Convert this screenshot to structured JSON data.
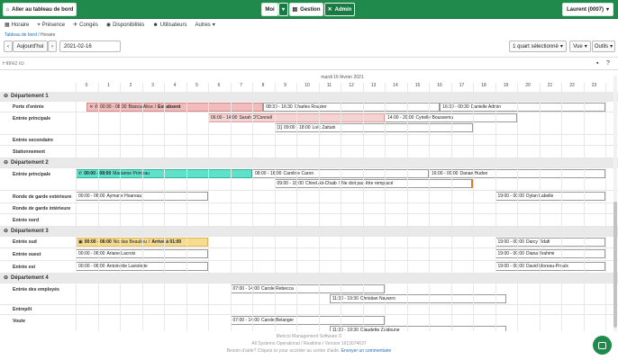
{
  "topbar": {
    "dashboard_label": "Aller au tableau de bord",
    "moi_label": "Moi",
    "gestion_label": "Gestion",
    "admin_label": "Admin",
    "user_label": "Laurent (0007)"
  },
  "nav": {
    "items": [
      "Horaire",
      "Présence",
      "Congés",
      "Disponibilités",
      "Utilisateurs",
      "Autres"
    ]
  },
  "breadcrumb": {
    "root": "Tableau de bord",
    "separator": "/",
    "current": "Horaire"
  },
  "toolbar": {
    "today_label": "Aujourd'hui",
    "date_value": "2021-02-16",
    "quarter_label": "1 quart sélectionné",
    "view_label": "Vue",
    "tools_label": "Outils"
  },
  "filter": {
    "placeholder": "Filtrez ici"
  },
  "timeline": {
    "date_header": "mardi 16 février 2021",
    "hours": [
      "0",
      "1",
      "2",
      "3",
      "4",
      "5",
      "6",
      "7",
      "8",
      "9",
      "10",
      "11",
      "12",
      "13",
      "14",
      "15",
      "16",
      "17",
      "18",
      "19",
      "20",
      "21",
      "22",
      "23"
    ]
  },
  "departments": [
    {
      "name": "Département 1"
    },
    {
      "name": "Département 2"
    },
    {
      "name": "Département 3"
    },
    {
      "name": "Département 4"
    }
  ],
  "positions": [
    "Porte d'entrée",
    "Entrée principale",
    "Entrée secondaire",
    "Stationnement",
    "Entrée principale",
    "Ronde de garde extérieure",
    "Ronde de garde intérieure",
    "Entrée nord",
    "Entrée sud",
    "Entrée ouest",
    "Entrée est",
    "Entrée des employés",
    "Entrepôt",
    "Voute"
  ],
  "shifts": [
    {
      "time": "00:30 - 08:30",
      "name": "Bianca Alice",
      "note": "Est absent",
      "start": 0.5,
      "end": 8.5,
      "style": "red",
      "icons": "✕ ✆"
    },
    {
      "time": "08:30 - 16:30",
      "name": "Charles Rouzier",
      "start": 8.5,
      "end": 16.5
    },
    {
      "time": "16:30 - 00:30",
      "name": "Danielle Admin",
      "start": 16.5,
      "end": 24
    },
    {
      "time": "06:00 - 14:00",
      "name": "Sarah O'Connell",
      "start": 6,
      "end": 14,
      "style": "pink"
    },
    {
      "time": "14:00 - 20:00",
      "name": "Cyrielle Boussema",
      "start": 14,
      "end": 20
    },
    {
      "time": "09:00 - 18:00",
      "name": "Loïc Zaituni",
      "prefix": "[1]",
      "start": 9,
      "end": 18
    },
    {
      "time": "00:00 - 08:00",
      "name": "Marianne Primeau",
      "start": 0,
      "end": 8,
      "style": "teal",
      "icons": "✆"
    },
    {
      "time": "08:00 - 16:00",
      "name": "Caroline Caron",
      "start": 8,
      "end": 16
    },
    {
      "time": "16:00 - 00:00",
      "name": "Danae Hudon",
      "start": 16,
      "end": 24
    },
    {
      "time": "09:00 - 18:00",
      "name": "Chirel Ait-Chaib",
      "note": "Ne doit pas être remplacé",
      "start": 9,
      "end": 18
    },
    {
      "time": "00:00 - 06:00",
      "name": "Aymane Hoareau",
      "start": 0,
      "end": 6
    },
    {
      "time": "19:00 - 00:00",
      "name": "Dylan Labelle",
      "start": 19,
      "end": 24
    },
    {
      "time": "00:00 - 06:00",
      "name": "Nicolas Beaulieu",
      "note": "Arrivé à 01:00",
      "start": 0,
      "end": 6,
      "style": "yel",
      "icons": "▣"
    },
    {
      "time": "19:00 - 00:00",
      "name": "Darcy Tidafi",
      "start": 19,
      "end": 24
    },
    {
      "time": "00:00 - 06:00",
      "name": "Ariane Lacroix",
      "start": 0,
      "end": 6
    },
    {
      "time": "19:00 - 00:00",
      "name": "Diana Brahimi",
      "start": 19,
      "end": 24
    },
    {
      "time": "00:00 - 06:00",
      "name": "Antoinette Laviolette",
      "start": 0,
      "end": 6
    },
    {
      "time": "19:00 - 00:00",
      "name": "David Moreau-Proulx",
      "start": 19,
      "end": 24
    },
    {
      "time": "07:00 - 14:00",
      "name": "Carole Rebecca",
      "start": 7,
      "end": 14
    },
    {
      "time": "11:30 - 19:30",
      "name": "Christian Navarro",
      "start": 11.5,
      "end": 19.5
    },
    {
      "time": "07:00 - 14:00",
      "name": "Carole Belanger",
      "start": 7,
      "end": 14
    },
    {
      "time": "11:30 - 19:30",
      "name": "Claudette Zaidoune",
      "start": 11.5,
      "end": 19.5
    }
  ],
  "footer": {
    "line1": "Mericio Management Software ©",
    "line2": "All Systems Operational / Realtime / Version 1613074637",
    "help_text": "Besoin d'aide? Cliquez ici pour accéder au centre d'aide.",
    "feedback_link": "Envoyer un commentaire"
  },
  "colors": {
    "brand": "#1f8a4c",
    "absent": "#f2bcbc",
    "phone": "#5fe0c9",
    "late": "#f6dc92"
  }
}
